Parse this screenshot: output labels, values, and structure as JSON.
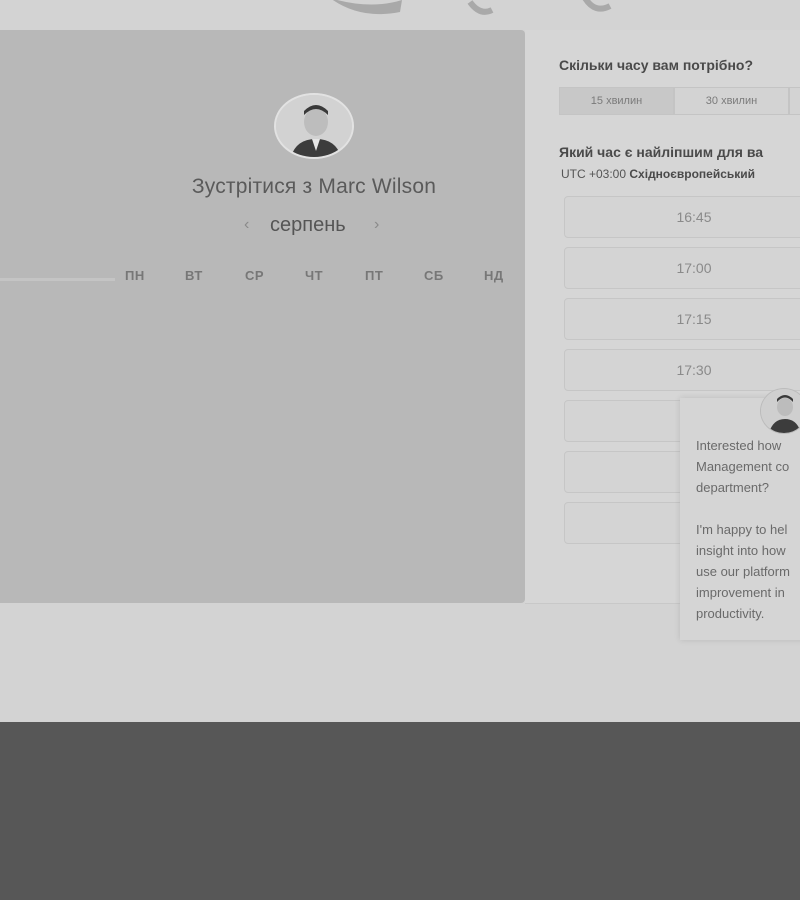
{
  "calendar": {
    "title": "Зустрітися з Marc Wilson",
    "month": "серпень",
    "prev_icon": "‹",
    "next_icon": "›",
    "weekdays": [
      "пн",
      "вт",
      "ср",
      "чт",
      "пт",
      "сб",
      "нд"
    ]
  },
  "scheduler": {
    "duration_question": "Скільки часу вам потрібно?",
    "durations": [
      "15 хвилин",
      "30 хвилин"
    ],
    "selected_duration": "15 хвилин",
    "time_question": "Який час є найліпшим для ва",
    "timezone_offset": "UTC +03:00",
    "timezone_name": "Східноєвропейський",
    "slots": [
      "16:45",
      "17:00",
      "17:15",
      "17:30",
      "",
      "",
      ""
    ]
  },
  "chat": {
    "message_1": "Interested how\nManagement co\ndepartment?",
    "message_2": "I'm happy to hel\ninsight into how\nuse our platform\nimprovement in\nproductivity."
  }
}
